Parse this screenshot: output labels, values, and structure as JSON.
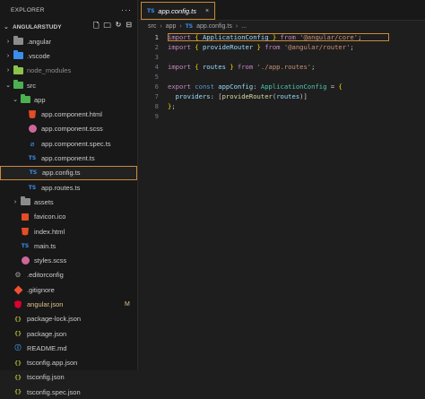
{
  "explorer": {
    "title": "EXPLORER",
    "more_icon": "ellipsis-icon",
    "project": {
      "name": "ANGULARSTUDY",
      "tools": [
        "new-file-icon",
        "new-folder-icon",
        "refresh-icon",
        "collapse-all-icon"
      ]
    },
    "items": [
      {
        "label": ".angular",
        "type": "folder",
        "arrow": "›",
        "color": "#8c8c8c",
        "depth": 1
      },
      {
        "label": ".vscode",
        "type": "folder",
        "arrow": "›",
        "color": "#3b8eea",
        "depth": 1
      },
      {
        "label": "node_modules",
        "type": "folder",
        "arrow": "›",
        "color": "#8bc34a",
        "depth": 1,
        "ignored": true
      },
      {
        "label": "src",
        "type": "folder",
        "arrow": "⌄",
        "color": "#4caf50",
        "depth": 1
      },
      {
        "label": "app",
        "type": "folder",
        "arrow": "⌄",
        "color": "#4caf50",
        "depth": 2
      },
      {
        "label": "app.component.html",
        "type": "html",
        "depth": 3
      },
      {
        "label": "app.component.scss",
        "type": "scss",
        "depth": 3
      },
      {
        "label": "app.component.spec.ts",
        "type": "spec",
        "depth": 3
      },
      {
        "label": "app.component.ts",
        "type": "ts",
        "depth": 3
      },
      {
        "label": "app.config.ts",
        "type": "ts",
        "depth": 3,
        "selected": true
      },
      {
        "label": "app.routes.ts",
        "type": "ts",
        "depth": 3
      },
      {
        "label": "assets",
        "type": "folder",
        "arrow": "›",
        "color": "#8c8c8c",
        "depth": 2
      },
      {
        "label": "favicon.ico",
        "type": "favicon",
        "depth": 2
      },
      {
        "label": "index.html",
        "type": "html",
        "depth": 2
      },
      {
        "label": "main.ts",
        "type": "ts",
        "depth": 2
      },
      {
        "label": "styles.scss",
        "type": "scss",
        "depth": 2
      },
      {
        "label": ".editorconfig",
        "type": "gear",
        "depth": 1
      },
      {
        "label": ".gitignore",
        "type": "git",
        "depth": 1
      },
      {
        "label": "angular.json",
        "type": "angular",
        "depth": 1,
        "badge": "M",
        "modified": true
      },
      {
        "label": "package-lock.json",
        "type": "json",
        "depth": 1
      },
      {
        "label": "package.json",
        "type": "json",
        "depth": 1
      },
      {
        "label": "README.md",
        "type": "md",
        "depth": 1
      },
      {
        "label": "tsconfig.app.json",
        "type": "json",
        "depth": 1
      },
      {
        "label": "tsconfig.json",
        "type": "json",
        "depth": 1
      },
      {
        "label": "tsconfig.spec.json",
        "type": "json",
        "depth": 1
      }
    ]
  },
  "editor": {
    "tab": {
      "icon_text": "TS",
      "label": "app.config.ts",
      "close": "×"
    },
    "breadcrumb": [
      "src",
      "app",
      "app.config.ts"
    ],
    "breadcrumb_icon_text": "TS",
    "breadcrumb_sep": "›",
    "breadcrumb_tail": "...",
    "lines": [
      {
        "n": "1",
        "active": true,
        "tokens": [
          [
            "kw",
            "import"
          ],
          [
            "pu",
            " "
          ],
          [
            "br",
            "{"
          ],
          [
            "pu",
            " "
          ],
          [
            "id",
            "ApplicationConfig"
          ],
          [
            "pu",
            " "
          ],
          [
            "br",
            "}"
          ],
          [
            "pu",
            " "
          ],
          [
            "kw",
            "from"
          ],
          [
            "pu",
            " "
          ],
          [
            "str",
            "'@angular/core'"
          ],
          [
            "pu",
            ";"
          ]
        ]
      },
      {
        "n": "2",
        "tokens": [
          [
            "kw",
            "import"
          ],
          [
            "pu",
            " "
          ],
          [
            "br",
            "{"
          ],
          [
            "pu",
            " "
          ],
          [
            "id",
            "provideRouter"
          ],
          [
            "pu",
            " "
          ],
          [
            "br",
            "}"
          ],
          [
            "pu",
            " "
          ],
          [
            "kw",
            "from"
          ],
          [
            "pu",
            " "
          ],
          [
            "str",
            "'@angular/router'"
          ],
          [
            "pu",
            ";"
          ]
        ]
      },
      {
        "n": "3",
        "tokens": []
      },
      {
        "n": "4",
        "tokens": [
          [
            "kw",
            "import"
          ],
          [
            "pu",
            " "
          ],
          [
            "br",
            "{"
          ],
          [
            "pu",
            " "
          ],
          [
            "id",
            "routes"
          ],
          [
            "pu",
            " "
          ],
          [
            "br",
            "}"
          ],
          [
            "pu",
            " "
          ],
          [
            "kw",
            "from"
          ],
          [
            "pu",
            " "
          ],
          [
            "str",
            "'./app.routes'"
          ],
          [
            "pu",
            ";"
          ]
        ]
      },
      {
        "n": "5",
        "tokens": []
      },
      {
        "n": "6",
        "tokens": [
          [
            "kw",
            "export"
          ],
          [
            "pu",
            " "
          ],
          [
            "kw2",
            "const"
          ],
          [
            "pu",
            " "
          ],
          [
            "id",
            "appConfig"
          ],
          [
            "pu",
            ": "
          ],
          [
            "ty",
            "ApplicationConfig"
          ],
          [
            "pu",
            " = "
          ],
          [
            "br",
            "{"
          ]
        ]
      },
      {
        "n": "7",
        "tokens": [
          [
            "pu",
            "  "
          ],
          [
            "id",
            "providers"
          ],
          [
            "pu",
            ": "
          ],
          [
            "pu",
            "["
          ],
          [
            "fn",
            "provideRouter"
          ],
          [
            "pu",
            "("
          ],
          [
            "id",
            "routes"
          ],
          [
            "pu",
            ")"
          ],
          [
            "pu",
            "]"
          ]
        ]
      },
      {
        "n": "8",
        "tokens": [
          [
            "br",
            "}"
          ],
          [
            "pu",
            ";"
          ]
        ]
      },
      {
        "n": "9",
        "tokens": []
      }
    ]
  }
}
